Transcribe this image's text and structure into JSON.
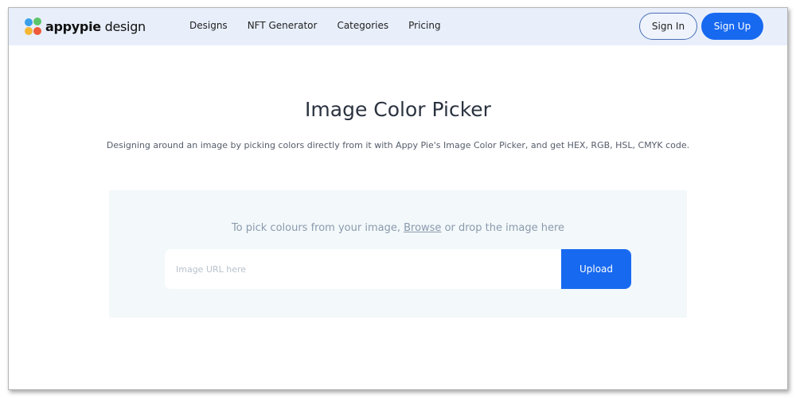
{
  "header": {
    "logo_bold": "appypie",
    "logo_light": " design",
    "nav": [
      "Designs",
      "NFT Generator",
      "Categories",
      "Pricing"
    ],
    "sign_in": "Sign In",
    "sign_up": "Sign Up"
  },
  "main": {
    "title": "Image Color Picker",
    "subtitle": "Designing around an image by picking colors directly from it with Appy Pie's Image Color Picker, and get HEX, RGB, HSL, CMYK code.",
    "pick_prefix": "To pick colours from your image, ",
    "browse": "Browse",
    "pick_suffix": " or drop the image here",
    "url_placeholder": "Image URL here",
    "upload": "Upload"
  },
  "colors": {
    "accent": "#1769f0",
    "header_bg": "#e8effb"
  }
}
